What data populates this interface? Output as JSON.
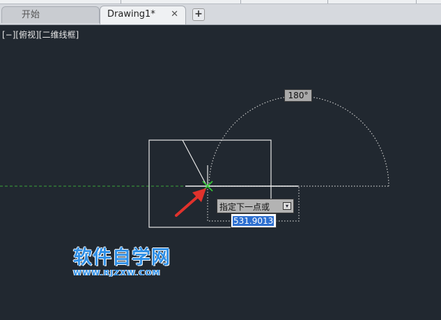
{
  "tabs": [
    {
      "label": "开始",
      "active": false
    },
    {
      "label": "Drawing1*",
      "active": true
    }
  ],
  "tab_close_glyph": "✕",
  "new_tab_glyph": "+",
  "viewport_label": "[−][俯视][二维线框]",
  "angle_tooltip": "180°",
  "command_prompt": "指定下一点或",
  "prompt_dropdown_glyph": "▾",
  "input_value": "531.9013",
  "watermark": {
    "title": "软件自学网",
    "url": "WWW.RJZXW.COM"
  },
  "colors": {
    "canvas_bg": "#212830",
    "polar_tracking_line": "#3aa33a",
    "arrow": "#e0322c",
    "cursor": "#33cc33",
    "watermark": "#2f8fe6"
  },
  "icons": {
    "close": "close-icon",
    "add": "plus-icon",
    "dropdown": "dropdown-arrow-icon",
    "pointer": "red-arrow-icon",
    "cursor": "crosshair-cursor-icon"
  }
}
